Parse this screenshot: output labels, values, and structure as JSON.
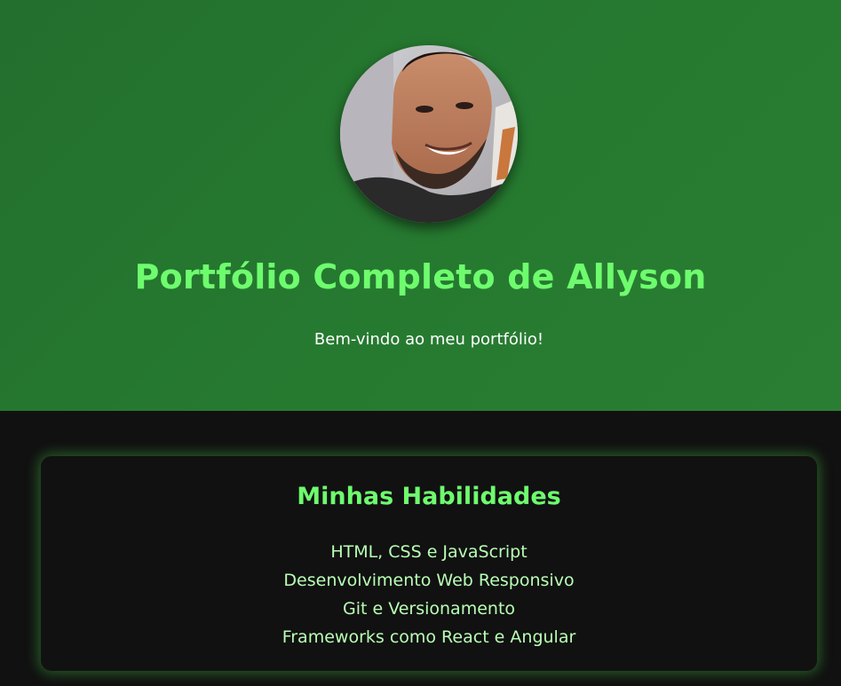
{
  "header": {
    "title": "Portfólio Completo de Allyson",
    "subtitle": "Bem-vindo ao meu portfólio!"
  },
  "skills": {
    "title": "Minhas Habilidades",
    "items": [
      "HTML, CSS e JavaScript",
      "Desenvolvimento Web Responsivo",
      "Git e Versionamento",
      "Frameworks como React e Angular"
    ]
  },
  "colors": {
    "hero_background": "#267a30",
    "accent_green": "#6efc6e",
    "skill_text": "#b9ffb5",
    "page_background": "#111111"
  }
}
